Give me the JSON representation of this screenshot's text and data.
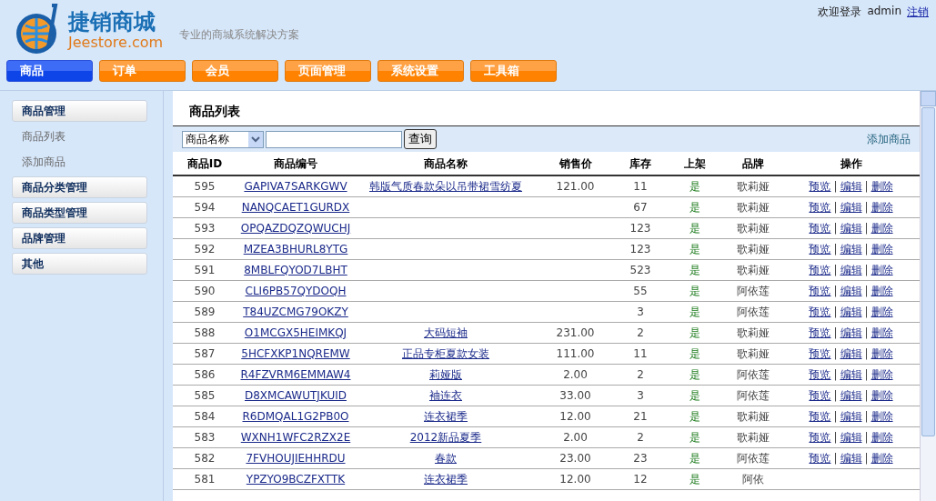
{
  "header": {
    "logo_title": "捷销商城",
    "logo_domain": "Jeestore.com",
    "tagline": "专业的商城系统解决方案",
    "welcome": "欢迎登录",
    "user": "admin",
    "logout": "注销"
  },
  "nav": [
    {
      "label": "商品",
      "selected": true
    },
    {
      "label": "订单",
      "selected": false
    },
    {
      "label": "会员",
      "selected": false
    },
    {
      "label": "页面管理",
      "selected": false
    },
    {
      "label": "系统设置",
      "selected": false
    },
    {
      "label": "工具箱",
      "selected": false
    }
  ],
  "sidebar": [
    {
      "label": "商品管理",
      "children": [
        {
          "label": "商品列表"
        },
        {
          "label": "添加商品"
        }
      ]
    },
    {
      "label": "商品分类管理"
    },
    {
      "label": "商品类型管理"
    },
    {
      "label": "品牌管理"
    },
    {
      "label": "其他"
    }
  ],
  "content": {
    "title": "商品列表",
    "search": {
      "select": "商品名称",
      "button": "查询"
    },
    "add_link": "添加商品",
    "table": {
      "columns": [
        "商品ID",
        "商品编号",
        "商品名称",
        "销售价",
        "库存",
        "上架",
        "品牌",
        "操作"
      ],
      "rows": [
        {
          "id": "595",
          "code": "GAPIVA7SARKGWV",
          "name": "韩版气质春款朵以吊带裙雪纺夏",
          "price": "121.00",
          "stock": "11",
          "listed": "是",
          "brand": "歌莉娅",
          "actions": [
            "预览",
            "|",
            "编辑",
            "|",
            "删除"
          ]
        },
        {
          "id": "594",
          "code": "NANQCAET1GURDX",
          "stock": "67",
          "listed": "是",
          "brand": "歌莉娅",
          "actions": [
            "预览",
            "|",
            "编辑",
            "|",
            "删除"
          ]
        },
        {
          "id": "593",
          "code": "OPQAZDQZQWUCHJ",
          "stock": "123",
          "listed": "是",
          "brand": "歌莉娅",
          "actions": [
            "预览",
            "|",
            "编辑",
            "|",
            "删除"
          ]
        },
        {
          "id": "592",
          "code": "MZEA3BHURL8YTG",
          "stock": "123",
          "listed": "是",
          "brand": "歌莉娅",
          "actions": [
            "预览",
            "|",
            "编辑",
            "|",
            "删除"
          ]
        },
        {
          "id": "591",
          "code": "8MBLFQYOD7LBHT",
          "stock": "523",
          "listed": "是",
          "brand": "歌莉娅",
          "actions": [
            "预览",
            "|",
            "编辑",
            "|",
            "删除"
          ]
        },
        {
          "id": "590",
          "code": "CLI6PB57QYDOQH",
          "stock": "55",
          "listed": "是",
          "brand": "阿依莲",
          "actions": [
            "预览",
            "|",
            "编辑",
            "|",
            "删除"
          ]
        },
        {
          "id": "589",
          "code": "T84UZCMG79OKZY",
          "stock": "3",
          "listed": "是",
          "brand": "阿依莲",
          "actions": [
            "预览",
            "|",
            "编辑",
            "|",
            "删除"
          ]
        },
        {
          "id": "588",
          "code": "O1MCGX5HEIMKQJ",
          "name": "大码短袖",
          "price": "231.00",
          "stock": "2",
          "listed": "是",
          "brand": "歌莉娅",
          "actions": [
            "预览",
            "|",
            "编辑",
            "|",
            "删除"
          ]
        },
        {
          "id": "587",
          "code": "5HCFXKP1NQREMW",
          "name": "正品专柜夏款女装",
          "price": "111.00",
          "stock": "11",
          "listed": "是",
          "brand": "歌莉娅",
          "actions": [
            "预览",
            "|",
            "编辑",
            "|",
            "删除"
          ]
        },
        {
          "id": "586",
          "code": "R4FZVRM6EMMAW4",
          "name": "莉娅版",
          "price": "2.00",
          "stock": "2",
          "listed": "是",
          "brand": "阿依莲",
          "actions": [
            "预览",
            "|",
            "编辑",
            "|",
            "删除"
          ]
        },
        {
          "id": "585",
          "code": "D8XMCAWUTJKUID",
          "name": "袖连衣",
          "price": "33.00",
          "stock": "3",
          "listed": "是",
          "brand": "阿依莲",
          "actions": [
            "预览",
            "|",
            "编辑",
            "|",
            "删除"
          ]
        },
        {
          "id": "584",
          "code": "R6DMQAL1G2PB0O",
          "name": "连衣裙季",
          "price": "12.00",
          "stock": "21",
          "listed": "是",
          "brand": "歌莉娅",
          "actions": [
            "预览",
            "|",
            "编辑",
            "|",
            "删除"
          ]
        },
        {
          "id": "583",
          "code": "WXNH1WFC2RZX2E",
          "name": "2012新品夏季",
          "price": "2.00",
          "stock": "2",
          "listed": "是",
          "brand": "歌莉娅",
          "actions": [
            "预览",
            "|",
            "编辑",
            "|",
            "删除"
          ]
        },
        {
          "id": "582",
          "code": "7FVHOUJIEHHRDU",
          "name": "春款",
          "price": "23.00",
          "stock": "23",
          "listed": "是",
          "brand": "阿依莲",
          "actions": [
            "预览",
            "|",
            "编辑",
            "|",
            "删除"
          ]
        },
        {
          "id": "581",
          "code": "YPZYO9BCZFXTTK",
          "name": "连衣裙季",
          "price": "12.00",
          "stock": "12",
          "listed": "是",
          "brand": "阿依"
        }
      ]
    }
  }
}
